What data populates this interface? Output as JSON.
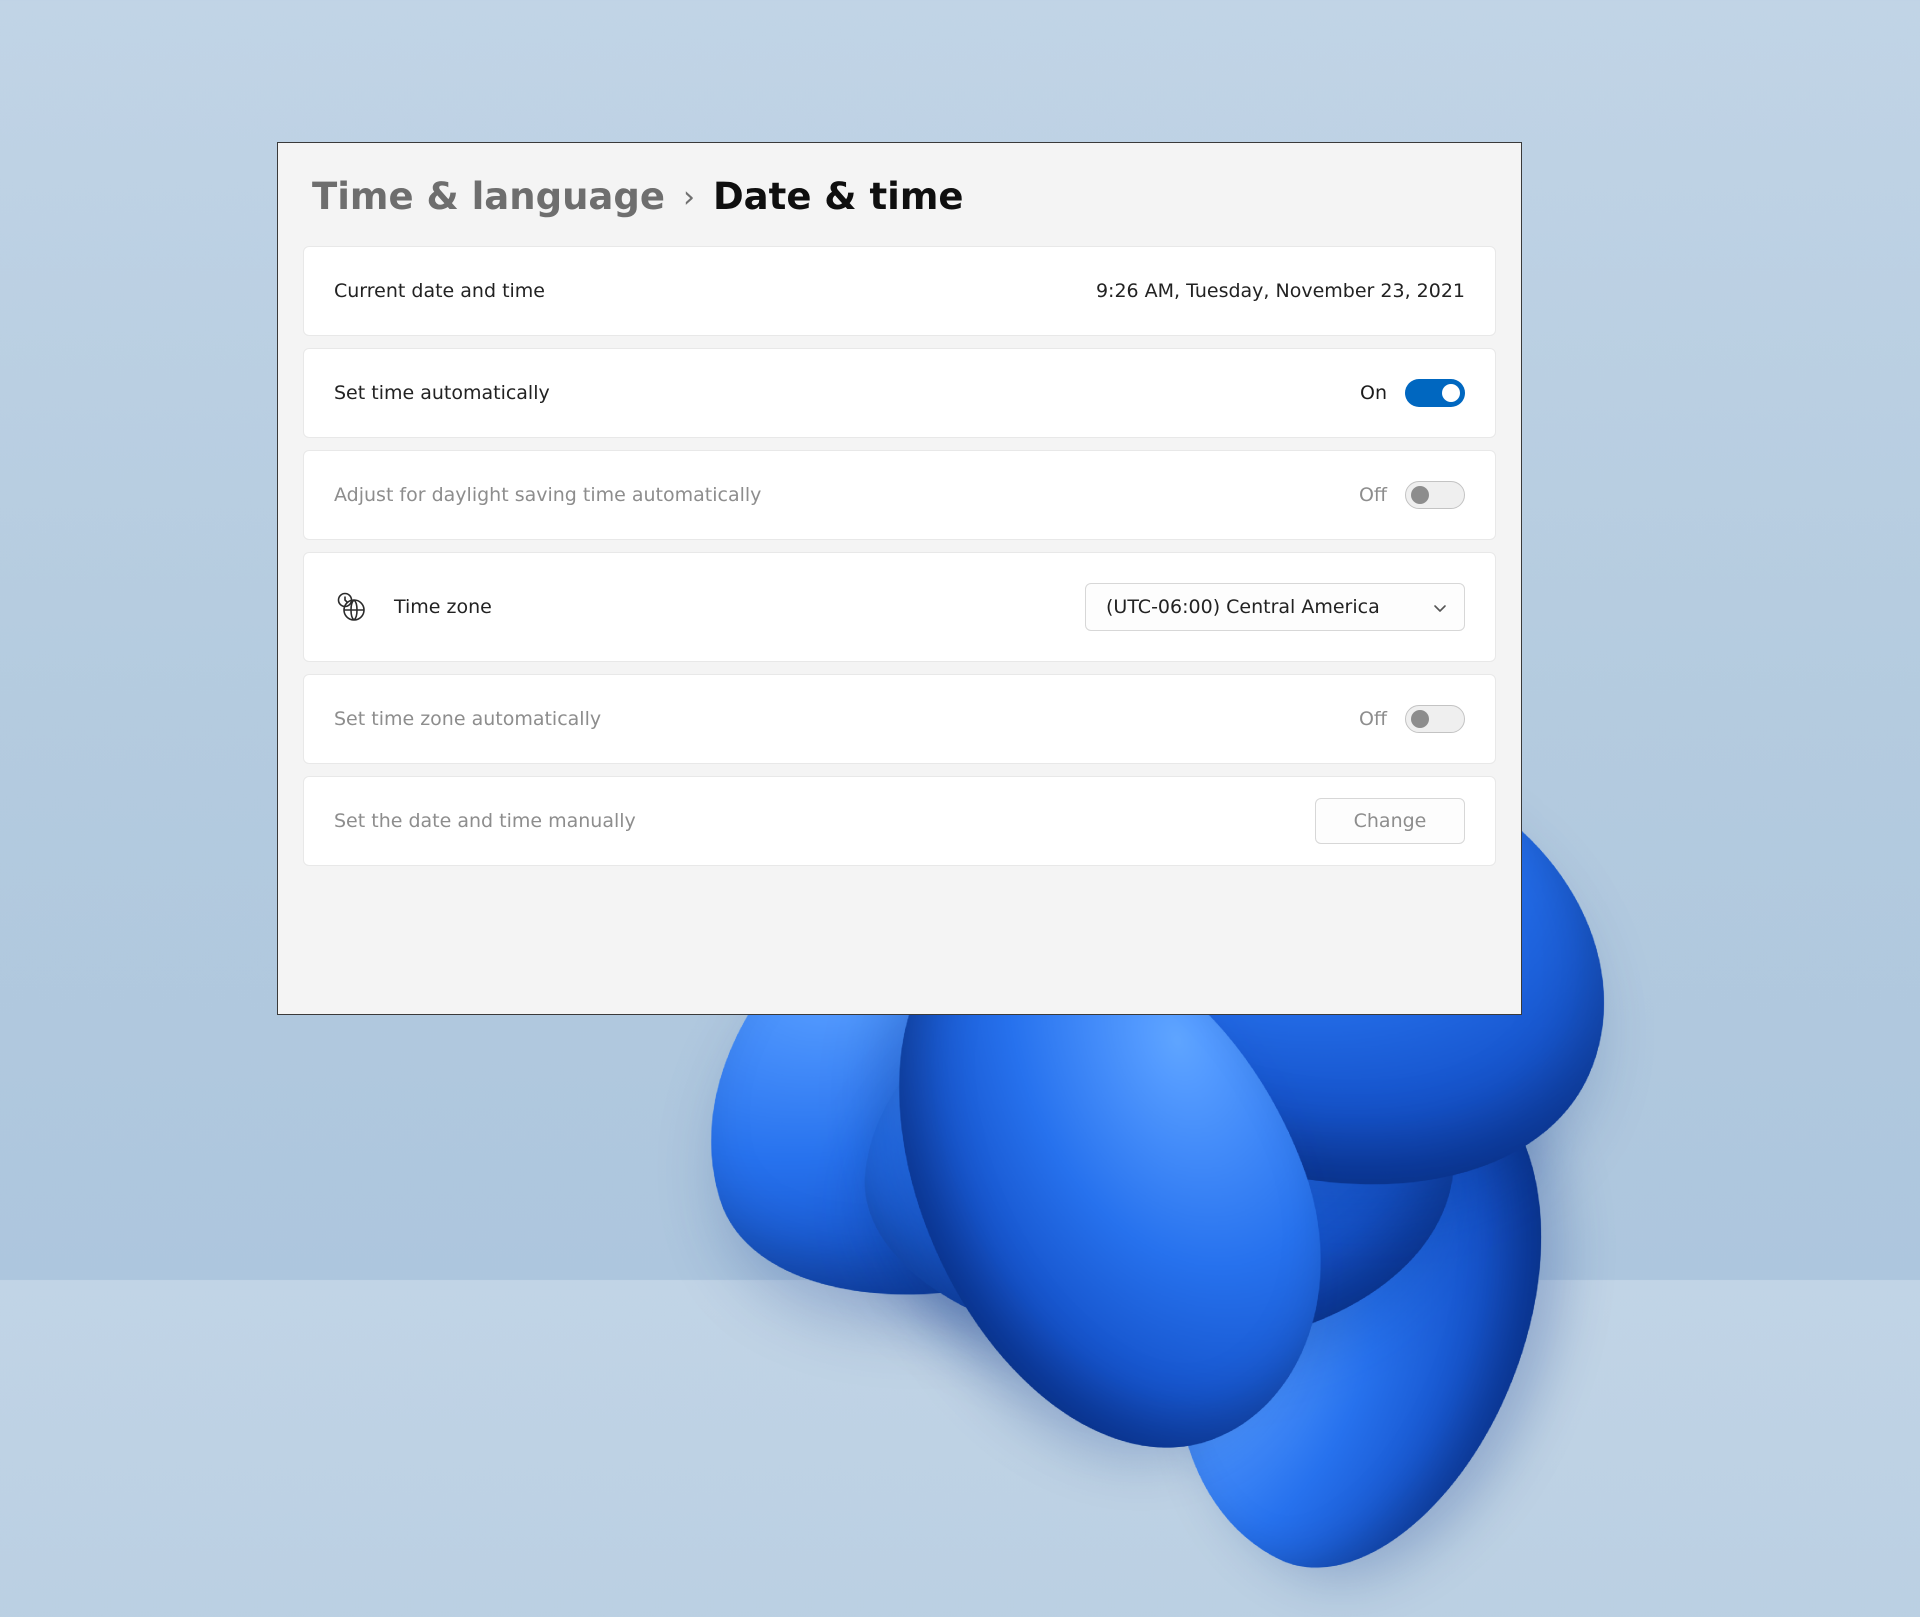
{
  "breadcrumb": {
    "parent": "Time & language",
    "separator": "›",
    "current": "Date & time"
  },
  "rows": {
    "current": {
      "label": "Current date and time",
      "value": "9:26 AM, Tuesday, November 23, 2021"
    },
    "auto_time": {
      "label": "Set time automatically",
      "state_label": "On",
      "on": true
    },
    "dst": {
      "label": "Adjust for daylight saving time automatically",
      "state_label": "Off",
      "on": false,
      "disabled": true
    },
    "timezone": {
      "label": "Time zone",
      "selected": "(UTC-06:00) Central America"
    },
    "auto_tz": {
      "label": "Set time zone automatically",
      "state_label": "Off",
      "on": false,
      "disabled": true
    },
    "manual": {
      "label": "Set the date and time manually",
      "button": "Change",
      "button_disabled": true
    }
  },
  "colors": {
    "accent": "#0067c0"
  }
}
